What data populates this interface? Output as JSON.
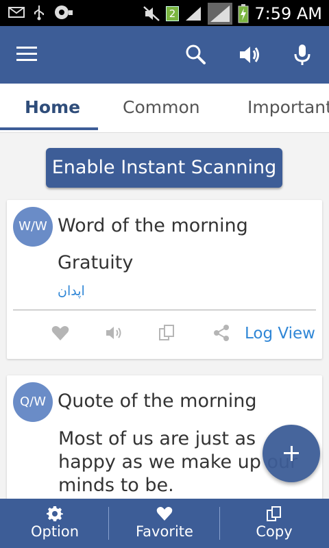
{
  "status_bar": {
    "time": "7:59 AM",
    "sim_badge": "2",
    "icons": [
      "mail-icon",
      "usb-icon",
      "voicemail-icon",
      "mute-icon",
      "signal-icon",
      "signal-icon-2",
      "battery-charging-icon"
    ]
  },
  "app_bar": {
    "icons": [
      "menu-icon",
      "search-icon",
      "speaker-icon",
      "microphone-icon"
    ],
    "color": "#3d5d97"
  },
  "tabs": [
    {
      "label": "Home",
      "active": true
    },
    {
      "label": "Common",
      "active": false
    },
    {
      "label": "Important",
      "active": false
    }
  ],
  "scan_button": {
    "label": "Enable Instant Scanning"
  },
  "card_word": {
    "badge": "W/W",
    "title": "Word of the morning",
    "word": "Gratuity",
    "translation": "اپدان",
    "action_icons": [
      "heart-icon",
      "speaker-icon",
      "copy-icon",
      "share-icon"
    ],
    "log_view": "Log View"
  },
  "card_quote": {
    "badge": "Q/W",
    "title": "Quote of the morning",
    "quote": "Most of us are just as happy as we make up our minds to be."
  },
  "bottom_bar": [
    {
      "label": "Option",
      "icon": "gear-icon"
    },
    {
      "label": "Favorite",
      "icon": "heart-icon"
    },
    {
      "label": "Copy",
      "icon": "copy-icon"
    }
  ],
  "colors": {
    "primary": "#3d5d97",
    "badge": "#6a8cc7",
    "link": "#2f86d6"
  }
}
